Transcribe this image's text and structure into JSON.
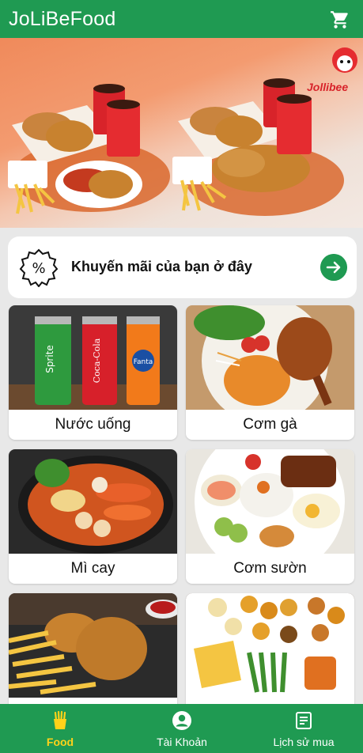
{
  "app": {
    "title": "JoLiBeFood"
  },
  "banner": {
    "brand_logo_text": "Jollibee"
  },
  "promo": {
    "text": "Khuyến mãi của bạn ở đây"
  },
  "categories": [
    {
      "label": "Nước uống",
      "image": "drinks"
    },
    {
      "label": "Cơm gà",
      "image": "chicken-rice"
    },
    {
      "label": "Mì cay",
      "image": "spicy-noodles"
    },
    {
      "label": "Cơm sườn",
      "image": "pork-rice"
    },
    {
      "label": "",
      "image": "fried-chicken"
    },
    {
      "label": "",
      "image": "snack-platter"
    }
  ],
  "nav": [
    {
      "label": "Food",
      "icon": "fries-icon",
      "active": true
    },
    {
      "label": "Tài Khoản",
      "icon": "account-icon",
      "active": false
    },
    {
      "label": "Lịch sử mua",
      "icon": "receipt-icon",
      "active": false
    }
  ],
  "colors": {
    "primary": "#1f9a52",
    "active_nav": "#ffd21a",
    "background": "#e8e8e8"
  }
}
